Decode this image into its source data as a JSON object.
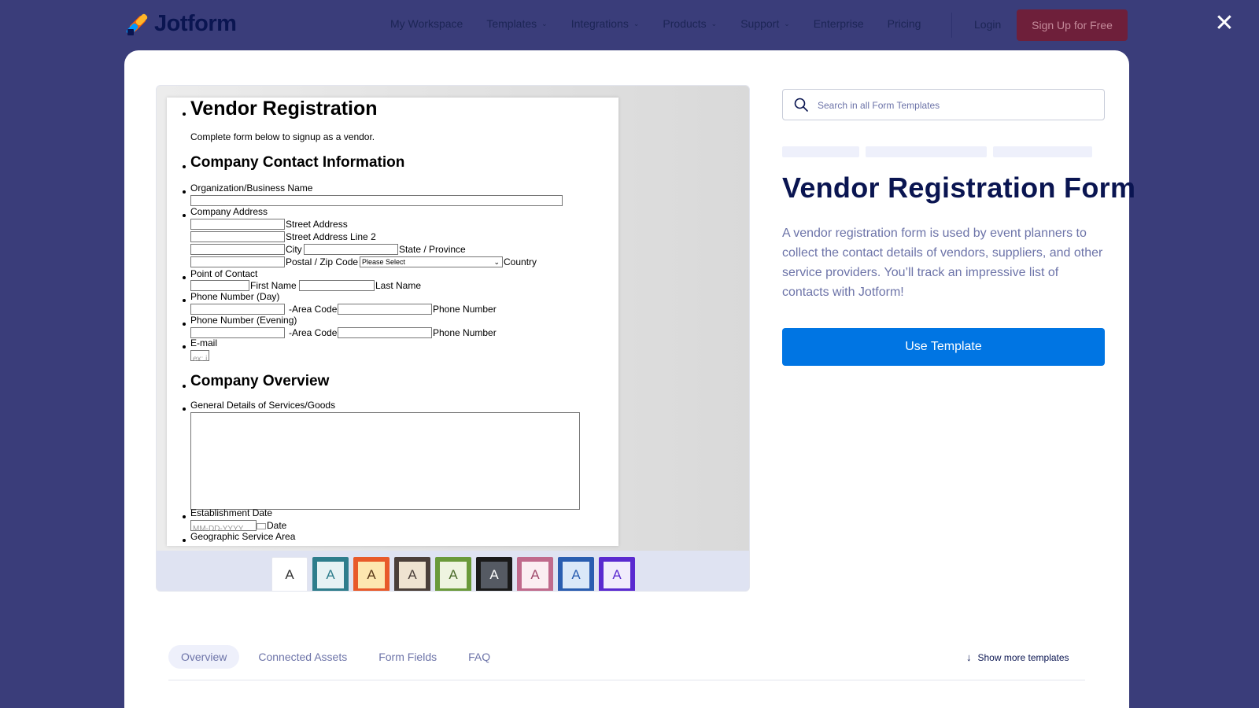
{
  "nav": {
    "logo": "Jotform",
    "items": [
      {
        "label": "My Workspace",
        "dropdown": false
      },
      {
        "label": "Templates",
        "dropdown": true
      },
      {
        "label": "Integrations",
        "dropdown": true
      },
      {
        "label": "Products",
        "dropdown": true
      },
      {
        "label": "Support",
        "dropdown": true
      },
      {
        "label": "Enterprise",
        "dropdown": false
      },
      {
        "label": "Pricing",
        "dropdown": false
      }
    ],
    "login": "Login",
    "signup": "Sign Up for Free",
    "close": "✕"
  },
  "preview": {
    "form_title": "Vendor Registration",
    "form_subtitle": "Complete form below to signup as a vendor.",
    "section_contact": "Company Contact Information",
    "org_name": "Organization/Business Name",
    "company_address": "Company Address",
    "street": "Street Address",
    "street2": "Street Address Line 2",
    "city": "City",
    "state": "State / Province",
    "postal": "Postal / Zip Code",
    "please_select": "Please Select",
    "country": "Country",
    "point_of_contact": "Point of Contact",
    "first_name": "First Name",
    "last_name": "Last Name",
    "phone_day": "Phone Number (Day)",
    "area_code": "-Area Code",
    "phone_number": "Phone Number",
    "phone_evening": "Phone Number (Evening)",
    "email": "E-mail",
    "email_placeholder": "ex: i",
    "section_overview": "Company Overview",
    "general_details": "General Details of Services/Goods",
    "establishment_date": "Establishment Date",
    "date_placeholder": "MM-DD-YYYY",
    "date": "Date",
    "geo_area": "Geographic Service Area"
  },
  "themes": [
    {
      "letter": "A",
      "border": "#ffffff",
      "fill": "#ffffff",
      "text": "#333333"
    },
    {
      "letter": "A",
      "border": "#2e7d8c",
      "fill": "#e6f2f4",
      "text": "#2e7d8c"
    },
    {
      "letter": "A",
      "border": "#e85a2a",
      "fill": "#fde7b0",
      "text": "#5a3a1a"
    },
    {
      "letter": "A",
      "border": "#4b3f3a",
      "fill": "#efe3d1",
      "text": "#4b3f3a"
    },
    {
      "letter": "A",
      "border": "#6a9a3a",
      "fill": "#eef4e0",
      "text": "#4a6a2a"
    },
    {
      "letter": "A",
      "border": "#1a1a1a",
      "fill": "#555a63",
      "text": "#ffffff"
    },
    {
      "letter": "A",
      "border": "#c06a8c",
      "fill": "#fbeef2",
      "text": "#a04a6c"
    },
    {
      "letter": "A",
      "border": "#2a5db0",
      "fill": "#dbe8f8",
      "text": "#2a5db0"
    },
    {
      "letter": "A",
      "border": "#5a2ad0",
      "fill": "#f1ecfc",
      "text": "#5a2ad0"
    }
  ],
  "search": {
    "placeholder": "Search in all Form Templates"
  },
  "title": "Vendor Registration Form",
  "description": "A vendor registration form is used by event planners to collect the contact details of vendors, suppliers, and other service providers. You’ll track an impressive list of contacts with Jotform!",
  "use_template": "Use Template",
  "tabs": [
    {
      "label": "Overview",
      "active": true
    },
    {
      "label": "Connected Assets",
      "active": false
    },
    {
      "label": "Form Fields",
      "active": false
    },
    {
      "label": "FAQ",
      "active": false
    }
  ],
  "show_more": "Show more templates"
}
